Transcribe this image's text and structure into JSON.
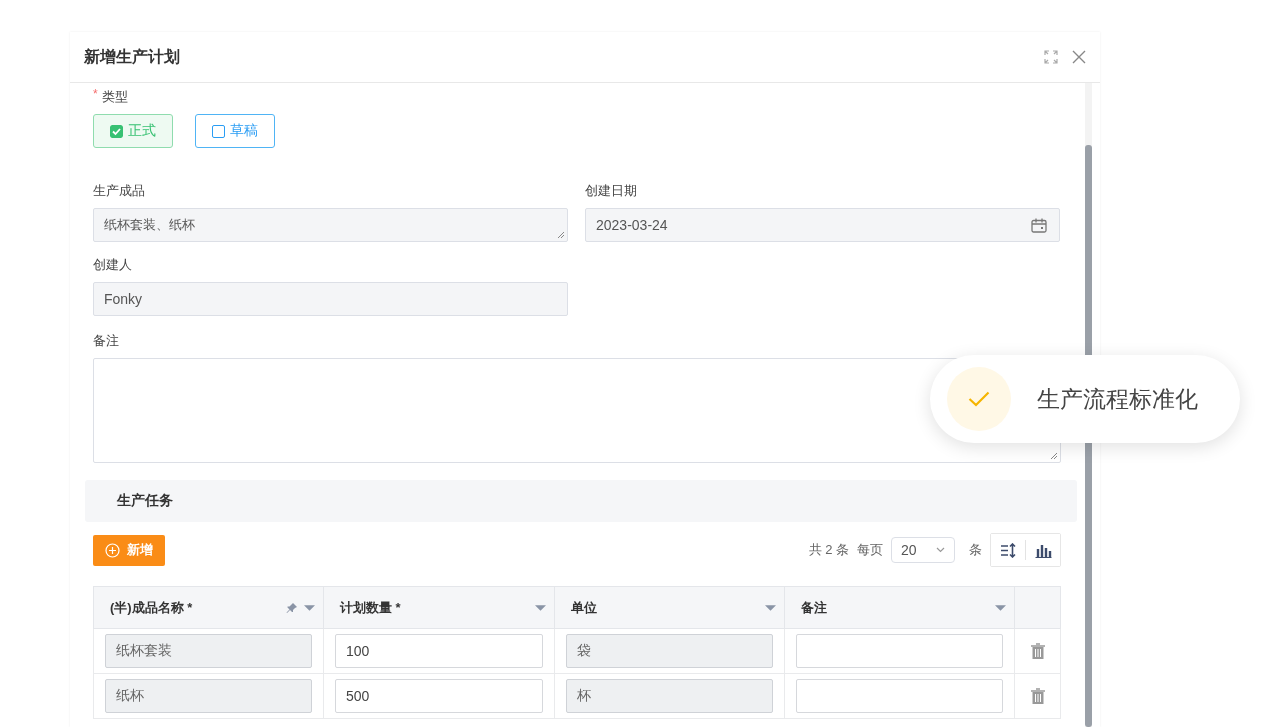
{
  "dialog": {
    "title": "新增生产计划"
  },
  "type_field": {
    "label": "类型",
    "required_mark": "*",
    "options": [
      {
        "label": "正式",
        "selected": true
      },
      {
        "label": "草稿",
        "selected": false
      }
    ]
  },
  "fields": [
    {
      "label": "生产成品",
      "value": "纸杯套装、纸杯",
      "kind": "textarea"
    },
    {
      "label": "创建日期",
      "value": "2023-03-24",
      "kind": "date"
    },
    {
      "label": "创建人",
      "value": "Fonky",
      "kind": "text"
    }
  ],
  "remarks": {
    "label": "备注"
  },
  "section": {
    "title": "生产任务"
  },
  "add_button": {
    "label": "新增"
  },
  "pagination": {
    "total": "共 2 条",
    "per_page_label": "每页",
    "page_size": "20",
    "unit": "条"
  },
  "table": {
    "columns": [
      {
        "label": "(半)成品名称 *",
        "pinned": true
      },
      {
        "label": "计划数量 *",
        "pinned": false
      },
      {
        "label": "单位",
        "pinned": false
      },
      {
        "label": "备注",
        "pinned": false
      }
    ],
    "rows": [
      {
        "cells": [
          {
            "value": "纸杯套装",
            "disabled": true
          },
          {
            "value": "100",
            "disabled": false
          },
          {
            "value": "袋",
            "disabled": true
          },
          {
            "disabled": false
          }
        ]
      },
      {
        "cells": [
          {
            "value": "纸杯",
            "disabled": true
          },
          {
            "value": "500",
            "disabled": false
          },
          {
            "value": "杯",
            "disabled": true
          },
          {
            "disabled": false
          }
        ]
      }
    ]
  },
  "toast": {
    "message": "生产流程标准化"
  }
}
